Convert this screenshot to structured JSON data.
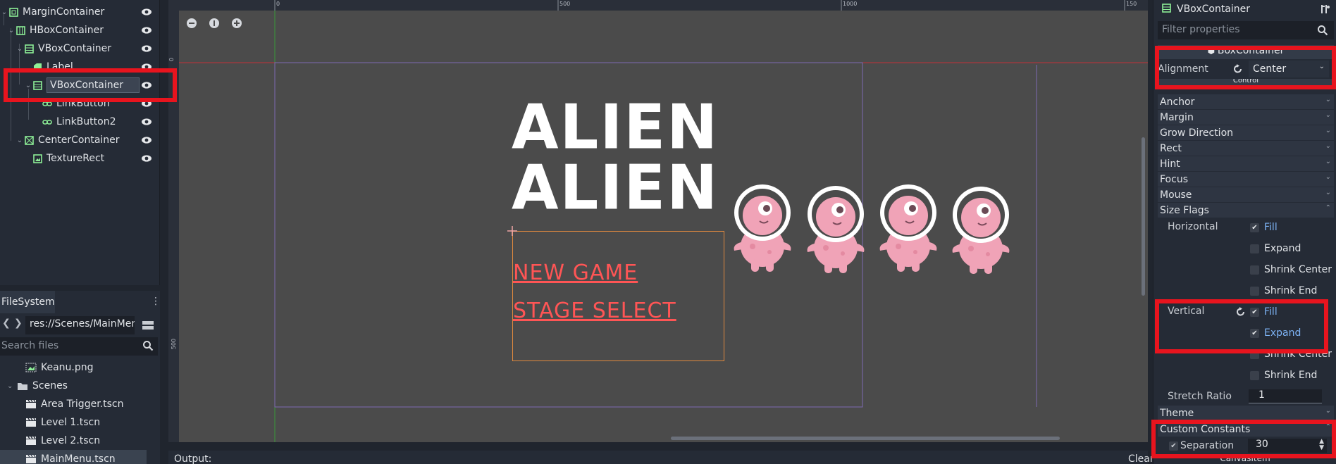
{
  "scene_tree": {
    "nodes": [
      {
        "label": "MarginContainer",
        "icon": "margin-container-icon",
        "depth": 0,
        "expanded": true
      },
      {
        "label": "HBoxContainer",
        "icon": "hbox-container-icon",
        "depth": 1,
        "expanded": true
      },
      {
        "label": "VBoxContainer",
        "icon": "vbox-container-icon",
        "depth": 2,
        "expanded": true
      },
      {
        "label": "Label",
        "icon": "label-icon",
        "depth": 3,
        "expanded": false
      },
      {
        "label": "VBoxContainer",
        "icon": "vbox-container-icon",
        "depth": 3,
        "expanded": true,
        "selected": true
      },
      {
        "label": "LinkButton",
        "icon": "link-button-icon",
        "depth": 4,
        "expanded": false
      },
      {
        "label": "LinkButton2",
        "icon": "link-button-icon",
        "depth": 4,
        "expanded": false
      },
      {
        "label": "CenterContainer",
        "icon": "center-container-icon",
        "depth": 2,
        "expanded": true
      },
      {
        "label": "TextureRect",
        "icon": "texture-rect-icon",
        "depth": 3,
        "expanded": false
      }
    ]
  },
  "filesystem": {
    "tab_label": "FileSystem",
    "path": "res://Scenes/MainMen",
    "search_placeholder": "Search files",
    "items": [
      {
        "label": "Keanu.png",
        "icon": "image-file-icon",
        "selected": false
      },
      {
        "label": "Scenes",
        "icon": "folder-icon",
        "selected": false
      },
      {
        "label": "Area Trigger.tscn",
        "icon": "scene-file-icon",
        "selected": false
      },
      {
        "label": "Level 1.tscn",
        "icon": "scene-file-icon",
        "selected": false
      },
      {
        "label": "Level 2.tscn",
        "icon": "scene-file-icon",
        "selected": false
      },
      {
        "label": "MainMenu.tscn",
        "icon": "scene-file-icon",
        "selected": true
      }
    ]
  },
  "viewport": {
    "ruler_labels": [
      "0",
      "500",
      "1000",
      "150"
    ],
    "ruler_left_labels": [
      "0",
      "500"
    ],
    "game_title_line1": "ALIEN",
    "game_title_line2": "ALIEN",
    "menu_items": [
      "NEW GAME",
      "STAGE SELECT"
    ],
    "alien_count": 4
  },
  "output": {
    "label": "Output:",
    "clear_label": "Clear"
  },
  "inspector": {
    "node_name": "VBoxContainer",
    "filter_placeholder": "Filter properties",
    "boxcontainer_section": "BoxContainer",
    "alignment_label": "Alignment",
    "alignment_value": "Center",
    "control_section": "Control",
    "categories": [
      "Anchor",
      "Margin",
      "Grow Direction",
      "Rect",
      "Hint",
      "Focus",
      "Mouse",
      "Size Flags"
    ],
    "horizontal_label": "Horizontal",
    "horizontal_flags": [
      {
        "label": "Fill",
        "checked": true
      },
      {
        "label": "Expand",
        "checked": false
      },
      {
        "label": "Shrink Center",
        "checked": false
      },
      {
        "label": "Shrink End",
        "checked": false
      }
    ],
    "vertical_label": "Vertical",
    "vertical_flags": [
      {
        "label": "Fill",
        "checked": true
      },
      {
        "label": "Expand",
        "checked": true
      },
      {
        "label": "Shrink Center",
        "checked": false
      },
      {
        "label": "Shrink End",
        "checked": false
      }
    ],
    "stretch_ratio_label": "Stretch Ratio",
    "stretch_ratio_value": "1",
    "theme_label": "Theme",
    "custom_constants_label": "Custom Constants",
    "separation_label": "Separation",
    "separation_value": "30",
    "canvasitem_section": "CanvasItem"
  },
  "colors": {
    "accent": "#7db3f5",
    "highlight": "#e8141e",
    "node_icon": "#8eef97",
    "menu_text": "#ff5555"
  }
}
